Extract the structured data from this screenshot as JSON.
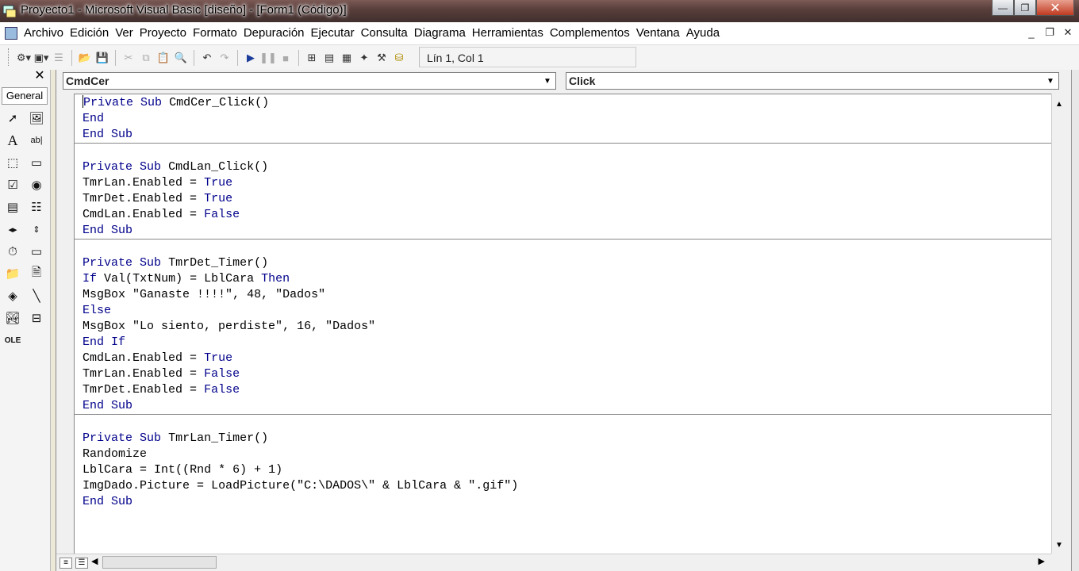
{
  "window": {
    "title": "Proyecto1 - Microsoft Visual Basic [diseño] - [Form1 (Código)]",
    "minimize_glyph": "—",
    "maximize_glyph": "❐",
    "close_glyph": "✕"
  },
  "menubar": {
    "items": [
      "Archivo",
      "Edición",
      "Ver",
      "Proyecto",
      "Formato",
      "Depuración",
      "Ejecutar",
      "Consulta",
      "Diagrama",
      "Herramientas",
      "Complementos",
      "Ventana",
      "Ayuda"
    ],
    "mdi_min": "_",
    "mdi_restore": "❐",
    "mdi_close": "✕"
  },
  "toolbar": {
    "position_text": "Lín 1, Col 1",
    "icons": [
      "add-project-icon",
      "add-form-icon",
      "menu-editor-icon",
      "open-icon",
      "save-icon",
      "cut-icon",
      "copy-icon",
      "paste-icon",
      "find-icon",
      "undo-icon",
      "redo-icon",
      "start-icon",
      "break-icon",
      "end-icon",
      "project-explorer-icon",
      "properties-icon",
      "form-layout-icon",
      "object-browser-icon",
      "toolbox-icon",
      "data-view-icon"
    ]
  },
  "toolbox": {
    "close_glyph": "✕",
    "tab_label": "General",
    "tools": [
      "pointer-icon",
      "picturebox-icon",
      "label-icon",
      "textbox-icon",
      "frame-icon",
      "commandbutton-icon",
      "checkbox-icon",
      "optionbutton-icon",
      "combobox-icon",
      "listbox-icon",
      "hscrollbar-icon",
      "vscrollbar-icon",
      "timer-icon",
      "drivelistbox-icon",
      "dirlistbox-icon",
      "filelistbox-icon",
      "shape-icon",
      "line-icon",
      "image-icon",
      "data-icon",
      "ole-icon"
    ]
  },
  "code_window": {
    "object_combo": "CmdCer",
    "procedure_combo": "Click",
    "procedures": [
      {
        "lines": [
          "Private Sub CmdCer_Click()",
          "End",
          "End Sub"
        ]
      },
      {
        "lines": [
          "Private Sub CmdLan_Click()",
          "TmrLan.Enabled = True",
          "TmrDet.Enabled = True",
          "CmdLan.Enabled = False",
          "End Sub"
        ]
      },
      {
        "lines": [
          "Private Sub TmrDet_Timer()",
          "If Val(TxtNum) = LblCara Then",
          "MsgBox \"Ganaste !!!!\", 48, \"Dados\"",
          "Else",
          "MsgBox \"Lo siento, perdiste\", 16, \"Dados\"",
          "End If",
          "CmdLan.Enabled = True",
          "TmrLan.Enabled = False",
          "TmrDet.Enabled = False",
          "End Sub"
        ]
      },
      {
        "lines": [
          "Private Sub TmrLan_Timer()",
          "Randomize",
          "LblCara = Int((Rnd * 6) + 1)",
          "ImgDado.Picture = LoadPicture(\"C:\\DADOS\\\" & LblCara & \".gif\")",
          "End Sub"
        ]
      }
    ],
    "keywords": [
      "Private",
      "Sub",
      "End",
      "If",
      "Then",
      "Else",
      "True",
      "False"
    ]
  }
}
